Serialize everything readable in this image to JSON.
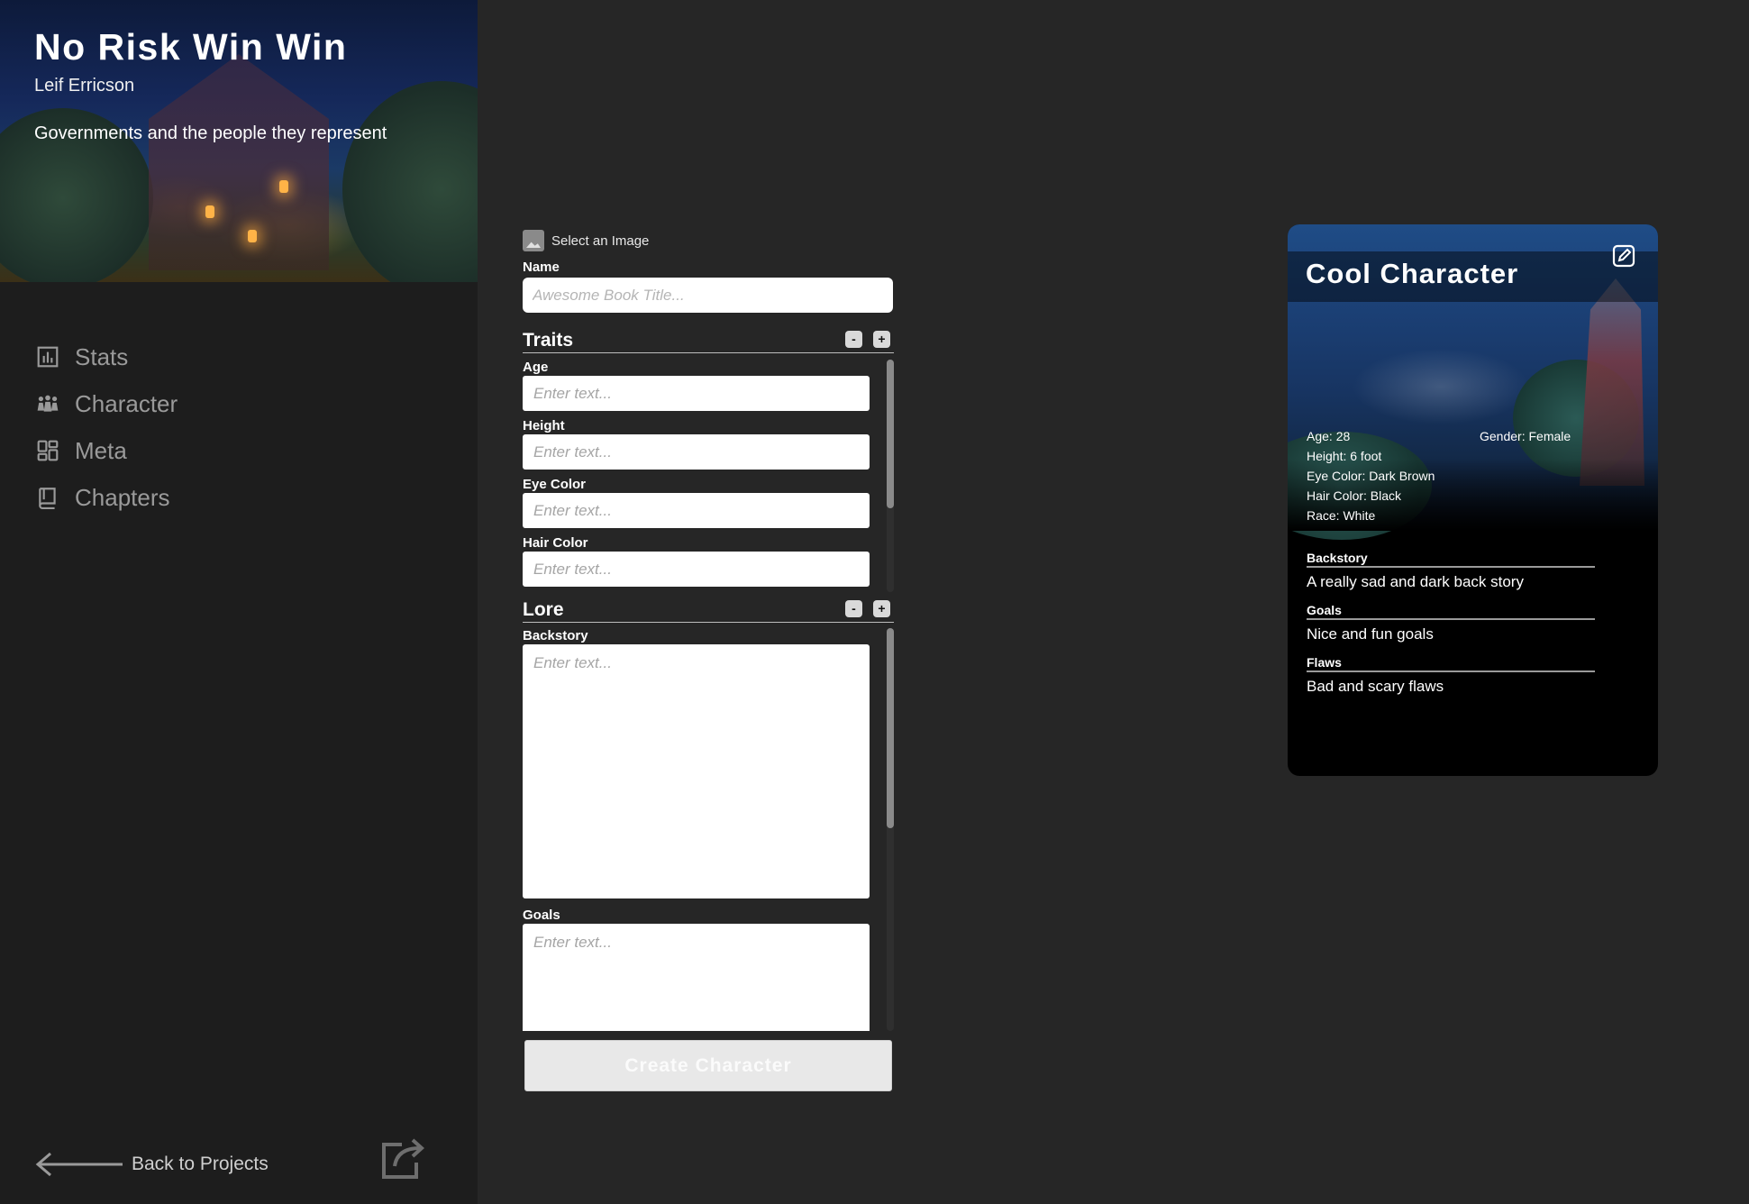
{
  "project": {
    "title": "No Risk Win Win",
    "author": "Leif Erricson",
    "description": "Governments and the people they represent"
  },
  "nav": {
    "items": [
      {
        "label": "Stats",
        "icon": "stats-icon"
      },
      {
        "label": "Character",
        "icon": "people-icon"
      },
      {
        "label": "Meta",
        "icon": "dashboard-icon"
      },
      {
        "label": "Chapters",
        "icon": "book-icon"
      }
    ]
  },
  "footer": {
    "back_label": "Back to Projects",
    "back_icon": "arrow-left-icon",
    "share_icon": "share-icon"
  },
  "form": {
    "select_image_label": "Select an Image",
    "name_label": "Name",
    "name_placeholder": "Awesome Book Title...",
    "traits": {
      "title": "Traits",
      "minus_label": "-",
      "plus_label": "+",
      "fields": [
        {
          "label": "Age",
          "placeholder": "Enter text..."
        },
        {
          "label": "Height",
          "placeholder": "Enter text..."
        },
        {
          "label": "Eye Color",
          "placeholder": "Enter text..."
        },
        {
          "label": "Hair Color",
          "placeholder": "Enter text..."
        }
      ]
    },
    "lore": {
      "title": "Lore",
      "minus_label": "-",
      "plus_label": "+",
      "fields": [
        {
          "label": "Backstory",
          "placeholder": "Enter text..."
        },
        {
          "label": "Goals",
          "placeholder": "Enter text..."
        }
      ]
    },
    "create_label": "Create Character"
  },
  "card": {
    "name": "Cool Character",
    "edit_icon": "edit-icon",
    "stats": {
      "age": "Age: 28",
      "gender": "Gender: Female",
      "height": "Height: 6 foot",
      "eye_color": "Eye Color: Dark Brown",
      "hair_color": "Hair Color: Black",
      "race": "Race: White"
    },
    "lore": [
      {
        "title": "Backstory",
        "text": "A really sad and dark back story"
      },
      {
        "title": "Goals",
        "text": "Nice and fun goals"
      },
      {
        "title": "Flaws",
        "text": "Bad and scary flaws"
      }
    ]
  }
}
